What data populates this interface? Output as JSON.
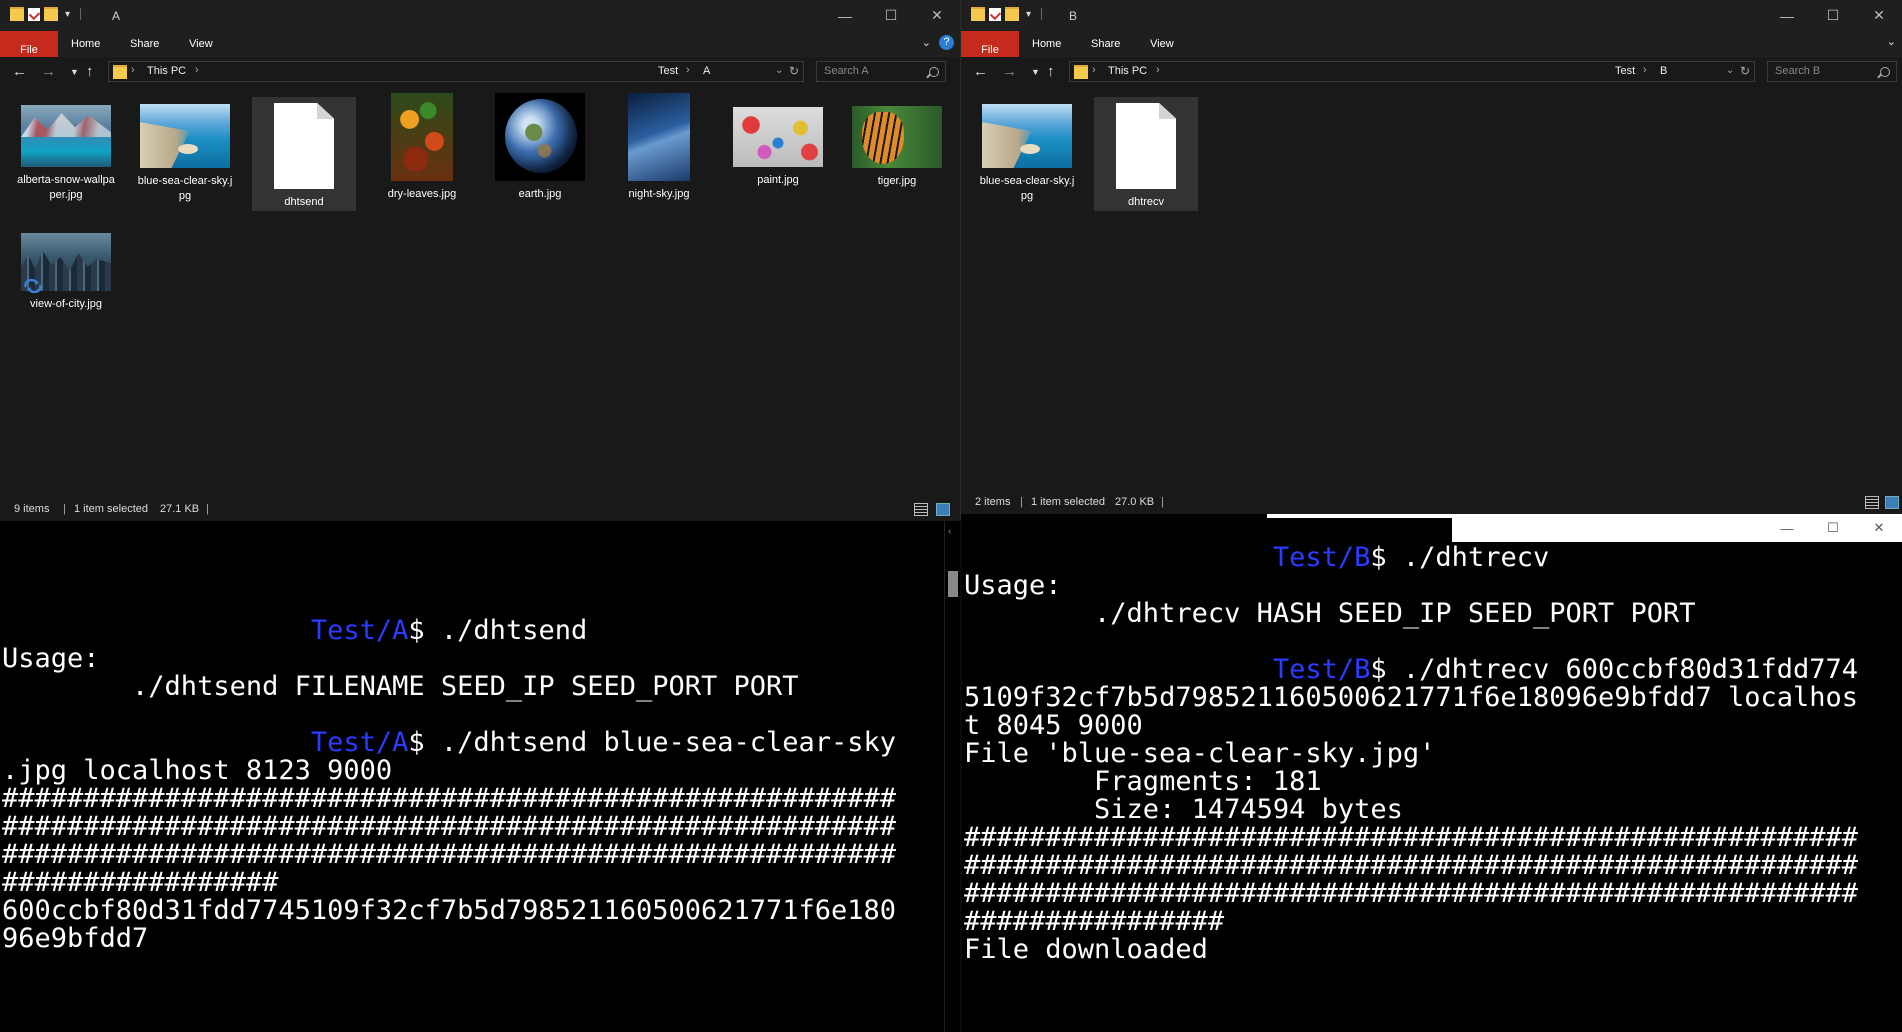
{
  "left_explorer": {
    "title": "A",
    "ribbon": {
      "file": "File",
      "home": "Home",
      "share": "Share",
      "view": "View"
    },
    "breadcrumb": [
      "This PC",
      "Test",
      "A"
    ],
    "search_placeholder": "Search A",
    "files": [
      {
        "name": "alberta-snow-wallpaper.jpg",
        "kind": "image"
      },
      {
        "name": "blue-sea-clear-sky.jpg",
        "kind": "image"
      },
      {
        "name": "dhtsend",
        "kind": "document",
        "selected": true
      },
      {
        "name": "dry-leaves.jpg",
        "kind": "image"
      },
      {
        "name": "earth.jpg",
        "kind": "image"
      },
      {
        "name": "night-sky.jpg",
        "kind": "image"
      },
      {
        "name": "paint.jpg",
        "kind": "image"
      },
      {
        "name": "tiger.jpg",
        "kind": "image"
      },
      {
        "name": "view-of-city.jpg",
        "kind": "image",
        "sync": true
      }
    ],
    "status": {
      "count": "9 items",
      "selected": "1 item selected",
      "size": "27.1 KB"
    }
  },
  "right_explorer": {
    "title": "B",
    "ribbon": {
      "file": "File",
      "home": "Home",
      "share": "Share",
      "view": "View"
    },
    "breadcrumb": [
      "This PC",
      "Test",
      "B"
    ],
    "search_placeholder": "Search B",
    "files": [
      {
        "name": "blue-sea-clear-sky.jpg",
        "kind": "image"
      },
      {
        "name": "dhtrecv",
        "kind": "document",
        "selected": true
      }
    ],
    "status": {
      "count": "2 items",
      "selected": "1 item selected",
      "size": "27.0 KB"
    }
  },
  "left_terminal": {
    "lines": [
      {
        "indent": "                   ",
        "prompt": "Test/A",
        "text": "$ ./dhtsend"
      },
      {
        "text": "Usage:"
      },
      {
        "text": "        ./dhtsend FILENAME SEED_IP SEED_PORT PORT"
      },
      {
        "text": ""
      },
      {
        "indent": "                   ",
        "prompt": "Test/A",
        "text": "$ ./dhtsend blue-sea-clear-sky"
      },
      {
        "text": ".jpg localhost 8123 9000"
      },
      {
        "text": "#######################################################"
      },
      {
        "text": "#######################################################"
      },
      {
        "text": "#######################################################"
      },
      {
        "text": "#################"
      },
      {
        "text": "600ccbf80d31fdd7745109f32cf7b5d798521160500621771f6e180"
      },
      {
        "text": "96e9bfdd7"
      }
    ]
  },
  "right_terminal": {
    "lines": [
      {
        "indent": "                   ",
        "prompt": "Test/B",
        "text": "$ ./dhtrecv"
      },
      {
        "text": "Usage:"
      },
      {
        "text": "        ./dhtrecv HASH SEED_IP SEED_PORT PORT"
      },
      {
        "text": ""
      },
      {
        "indent": "                   ",
        "prompt": "Test/B",
        "text": "$ ./dhtrecv 600ccbf80d31fdd774"
      },
      {
        "text": "5109f32cf7b5d798521160500621771f6e18096e9bfdd7 localhos"
      },
      {
        "text": "t 8045 9000"
      },
      {
        "text": "File 'blue-sea-clear-sky.jpg'"
      },
      {
        "text": "        Fragments: 181"
      },
      {
        "text": "        Size: 1474594 bytes"
      },
      {
        "text": "#######################################################"
      },
      {
        "text": "#######################################################"
      },
      {
        "text": "#######################################################"
      },
      {
        "text": "################"
      },
      {
        "text": "File downloaded"
      }
    ]
  },
  "colors": {
    "explorer_bg": "#191919",
    "file_tab": "#c42b1c",
    "prompt": "#2a3cff",
    "selection": "#333333"
  }
}
